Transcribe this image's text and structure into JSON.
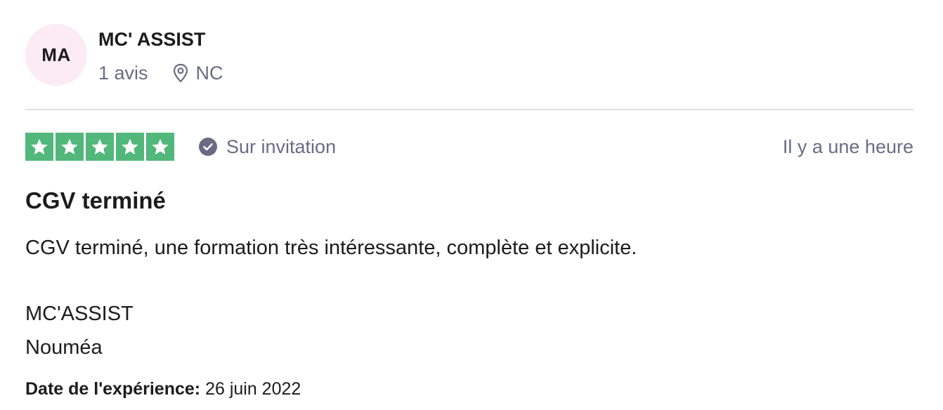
{
  "reviewer": {
    "initials": "MA",
    "name": "MC' ASSIST",
    "review_count": "1 avis",
    "location": "NC",
    "location_icon": "map-pin-icon",
    "avatar_color": "#fcebf3"
  },
  "rating": {
    "stars": 5,
    "max_stars": 5,
    "star_color": "#51b77b",
    "verified_icon": "check-circle-icon",
    "verified_label": "Sur invitation",
    "time_ago": "Il y a une heure"
  },
  "review": {
    "title": "CGV terminé",
    "body": "CGV terminé, une formation très intéressante, complète et explicite.",
    "signature_line_1": "MC'ASSIST",
    "signature_line_2": "Nouméa"
  },
  "experience": {
    "label": "Date de l'expérience:",
    "date": "26 juin 2022"
  },
  "colors": {
    "text_primary": "#1c1c1c",
    "text_secondary": "#6b6b85",
    "divider": "#e0e0e0"
  }
}
